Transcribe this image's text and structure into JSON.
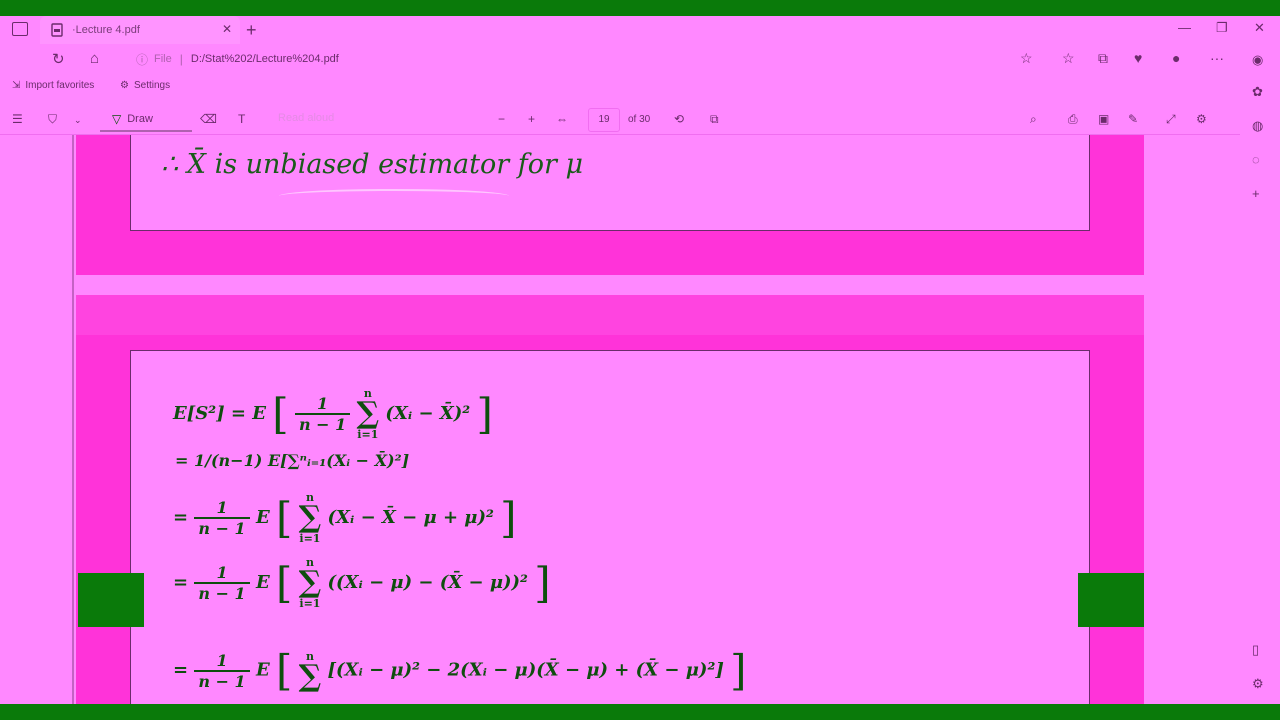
{
  "browser": {
    "tab_title": "·Lecture 4.pdf",
    "address_prefix": "File",
    "url": "D:/Stat%202/Lecture%204.pdf",
    "favorites": [
      {
        "label": "Import favorites",
        "icon": "import-icon"
      },
      {
        "label": "Settings",
        "icon": "gear-icon"
      }
    ]
  },
  "pdf_toolbar": {
    "draw_label": "Draw",
    "read_aloud_label": "Read aloud",
    "page_current": "19",
    "page_total": "of 30"
  },
  "slides": {
    "prev_statement": "∴  X̄ is unbiased estimator for μ",
    "lines": {
      "l1_lhs": "E[S²] = E",
      "l1_num": "1",
      "l1_den": "n − 1",
      "l1_sum_top": "n",
      "l1_sum_bot": "i=1",
      "l1_term": "(Xᵢ − X̄)²",
      "l2": "= 1/(n−1) E[∑ⁿᵢ₌₁(Xᵢ − X̄)²]",
      "l3_term": "(Xᵢ − X̄ − μ + μ)²",
      "l4_term": "((Xᵢ − μ) − (X̄ − μ))²",
      "l5_term": "[(Xᵢ − μ)² − 2(Xᵢ − μ)(X̄ − μ) + (X̄ − μ)²]"
    }
  },
  "colors": {
    "background": "#ff88ff",
    "slide_frame": "#ff33d9",
    "math_text": "#0e4e0e",
    "green_bar": "#0a7a0a"
  }
}
